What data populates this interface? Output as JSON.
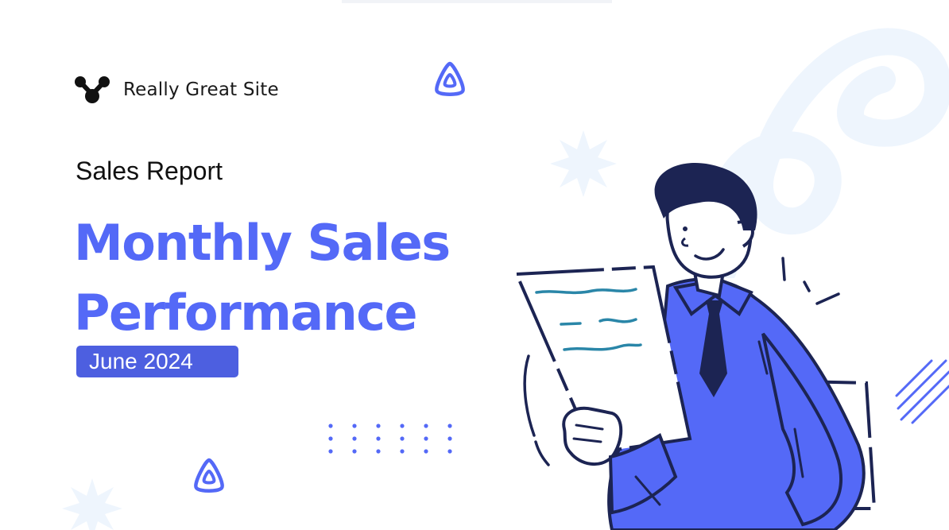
{
  "brand": {
    "name": "Really Great Site",
    "logo_icon": "molecule-logo-icon"
  },
  "header": {
    "subtitle": "Sales Report",
    "title_line1": "Monthly Sales",
    "title_line2": "Performance"
  },
  "badge": {
    "date": "June 2024"
  },
  "colors": {
    "accent": "#5469f7",
    "badge": "#4d5fe0",
    "navy": "#1c2453",
    "light_blue": "#eef5fd",
    "teal": "#2a86a8"
  },
  "decorations": {
    "icons": [
      "rounded-triangle-icon",
      "starburst-icon",
      "dot-grid-icon",
      "diagonal-lines-icon",
      "loop-swirl-icon"
    ],
    "illustration": "businessman-reading-document-illustration"
  }
}
